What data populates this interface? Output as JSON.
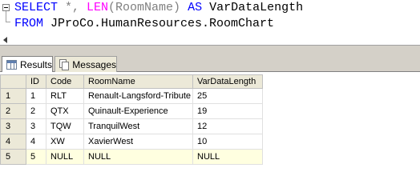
{
  "query": {
    "line1": {
      "kw_select": "SELECT",
      "star": " *, ",
      "fn_len": "LEN",
      "args": "(RoomName)",
      "kw_as": " AS ",
      "alias": "VarDataLength"
    },
    "line2": {
      "kw_from": "FROM",
      "table": " JProCo.HumanResources.RoomChart"
    }
  },
  "tabs": [
    {
      "label": "Results",
      "icon": "grid-icon",
      "active": true
    },
    {
      "label": "Messages",
      "icon": "messages-icon",
      "active": false
    }
  ],
  "grid": {
    "columns": [
      "",
      "ID",
      "Code",
      "RoomName",
      "VarDataLength"
    ],
    "rows": [
      [
        "1",
        "1",
        "RLT",
        "Renault-Langsford-Tribute",
        "25"
      ],
      [
        "2",
        "2",
        "QTX",
        "Quinault-Experience",
        "19"
      ],
      [
        "3",
        "3",
        "TQW",
        "TranquilWest",
        "12"
      ],
      [
        "4",
        "4",
        "XW",
        "XavierWest",
        "10"
      ],
      [
        "5",
        "5",
        "NULL",
        "NULL",
        "NULL"
      ]
    ],
    "selected_row": 5
  },
  "colors": {
    "keyword": "#0000ff",
    "function": "#ff00ff",
    "highlight": "#ffffe0"
  }
}
